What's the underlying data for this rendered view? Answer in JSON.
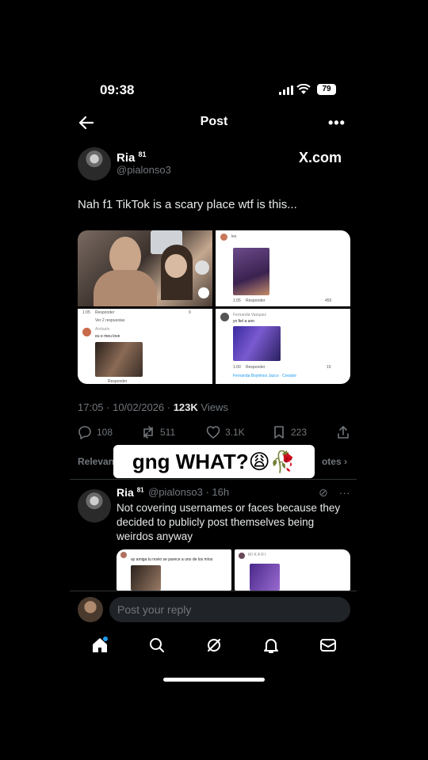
{
  "status_bar": {
    "time": "09:38",
    "battery": "79"
  },
  "header": {
    "title": "Post"
  },
  "post": {
    "author_name": "Ria",
    "author_badge": "81",
    "author_handle": "@pialonso3",
    "source": "X.com",
    "text": "Nah f1 TikTok is a scary place wtf is this...",
    "timestamp": "17:05 · 10/02/2026 · ",
    "views_count": "123K",
    "views_label": " Views",
    "stats": {
      "replies": "108",
      "reposts": "511",
      "likes": "3.1K",
      "bookmarks": "223"
    },
    "media": {
      "c2_header": "les",
      "c2_footer_left": "1:05",
      "c2_footer_reply": "Responder",
      "c2_footer_count": "455",
      "c3_top_left": "1:05",
      "c3_top_reply": "Responder",
      "c3_top_count": "9",
      "c3_more": "Ver 2 respuestas",
      "c3_user": "Andaale",
      "c3_caption": "eu e meu love",
      "c3_footer_reply": "Responder",
      "c4_user": "Fernanda Vazquez",
      "c4_caption": "yo fiel a uno",
      "c4_footer_left": "1:00",
      "c4_footer_reply": "Responder",
      "c4_footer_count": "15",
      "c4_creator": "Fernanda Boylimos Jazco · Creador"
    }
  },
  "replies_filter": {
    "left": "Relevan",
    "right": "otes"
  },
  "overlay_caption": "gng WHAT?😩🥀",
  "reply": {
    "author_name": "Ria",
    "author_badge": "81",
    "handle_time": "@pialonso3 · 16h",
    "text": "Not covering usernames or faces because they decided to publicly post themselves being weirdos anyway",
    "media": {
      "left_caption": "ay amiga tu novio se parece a uno de los míos",
      "right_user": "MIKARI"
    }
  },
  "compose": {
    "placeholder": "Post your reply"
  },
  "icons": [
    "back-arrow-icon",
    "more-icon",
    "reply-icon",
    "repost-icon",
    "like-icon",
    "bookmark-icon",
    "share-icon",
    "home-icon",
    "search-icon",
    "grok-icon",
    "notifications-icon",
    "messages-icon"
  ],
  "colors": {
    "background": "#000000",
    "muted": "#71767b",
    "text": "#e7e9ea",
    "accent": "#1d9bf0"
  }
}
